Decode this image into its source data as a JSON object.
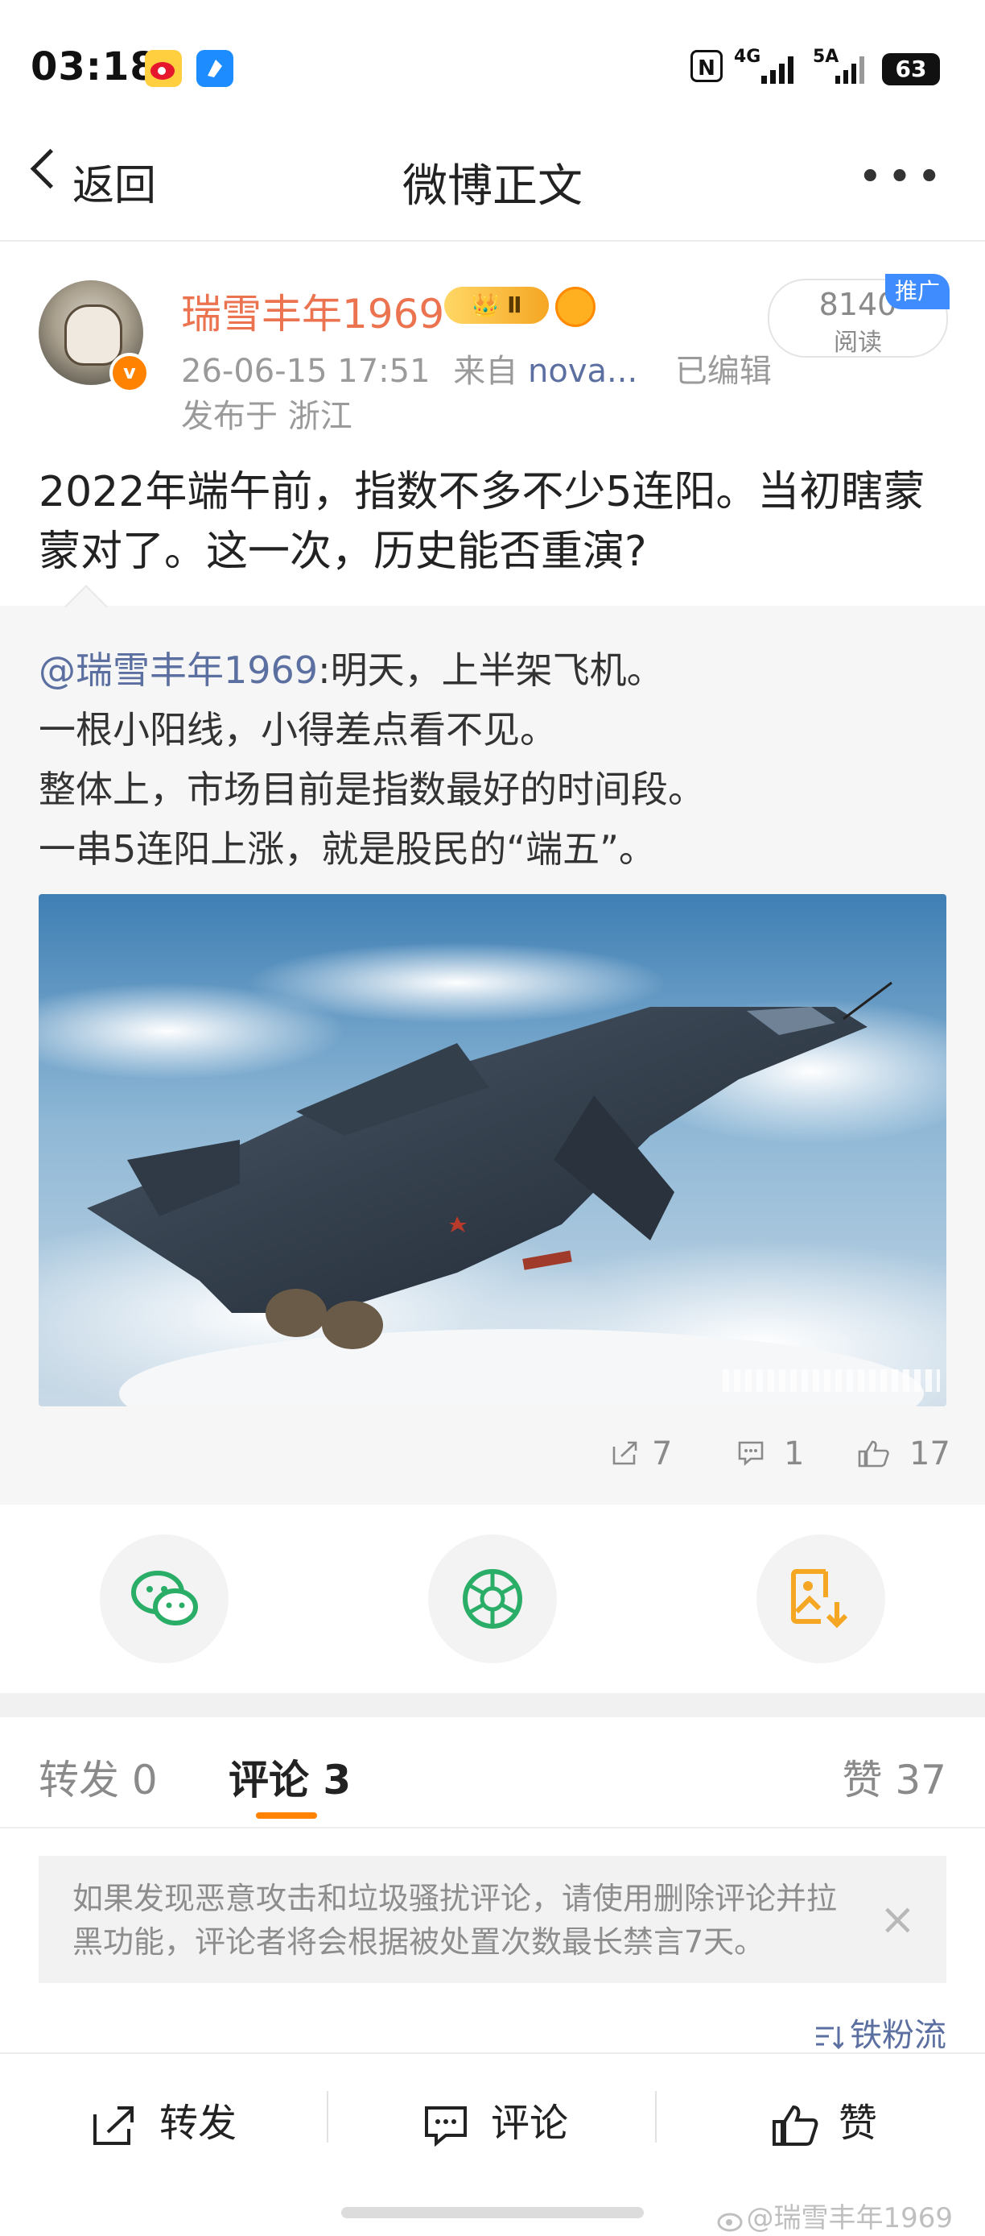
{
  "status_bar": {
    "time": "03:18",
    "nfc": "N",
    "signal1": "4G",
    "signal2": "5A",
    "battery": "63"
  },
  "nav": {
    "back_label": "返回",
    "title": "微博正文",
    "more": "•••"
  },
  "post": {
    "author": "瑞雪丰年1969",
    "level_badge": "Ⅱ",
    "date": "26-06-15 17:51",
    "source_prefix": "来自",
    "source": "nova...",
    "edited": "已编辑",
    "location": "发布于 浙江",
    "reads_count": "8140",
    "reads_label": "阅读",
    "promo_badge": "推广",
    "text": "2022年端午前，指数不多不少5连阳。当初瞎蒙蒙对了。这一次，历史能否重演?"
  },
  "repost": {
    "mention": "@瑞雪丰年1969",
    "lines": [
      ":明天，上半架飞机。",
      "一根小阳线，小得差点看不见。",
      "整体上，市场目前是指数最好的时间段。",
      "一串5连阳上涨，就是股民的“端五”。"
    ],
    "stats": {
      "reposts": "7",
      "comments": "1",
      "likes": "17"
    }
  },
  "share_row": {
    "items": [
      "wechat-share-icon",
      "moments-share-icon",
      "save-image-icon"
    ]
  },
  "tabs": {
    "repost_label": "转发 0",
    "comment_label": "评论 3",
    "like_label": "赞 37"
  },
  "notice": {
    "text": "如果发现恶意攻击和垃圾骚扰评论，请使用删除评论并拉黑功能，评论者将会根据被处置次数最长禁言7天。",
    "close": "×"
  },
  "sort": {
    "label": "铁粉流"
  },
  "bottom_bar": {
    "repost": "转发",
    "comment": "评论",
    "like": "赞"
  },
  "watermark": "@瑞雪丰年1969",
  "colors": {
    "accent": "#ff8200",
    "author_name": "#eb7350",
    "link": "#5b6fa0",
    "promo": "#3f8cff",
    "wechat_green": "#2aae67",
    "save_orange": "#f5a623"
  }
}
